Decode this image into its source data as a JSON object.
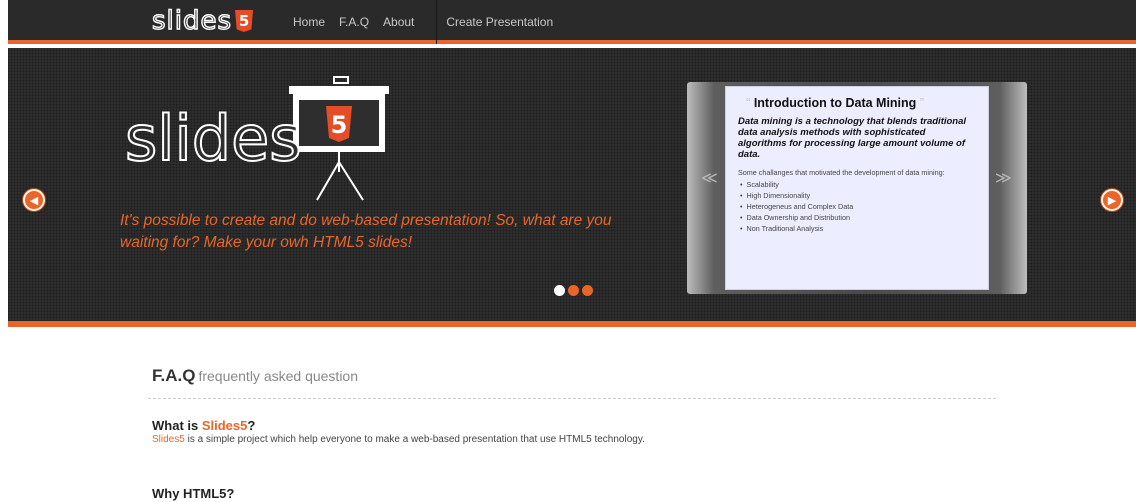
{
  "nav": {
    "logo_text": "slides",
    "logo_badge": "5",
    "home": "Home",
    "faq": "F.A.Q",
    "about": "About",
    "create": "Create Presentation"
  },
  "hero": {
    "big_logo_text": "slides",
    "big_logo_badge": "5",
    "tagline": "It's possible to create and do web-based presentation! So, what are you waiting for? Make your owh HTML5 slides!",
    "active_slide": 1,
    "slide_count": 3,
    "prev_arrow": "◀",
    "next_arrow": "▶"
  },
  "preview": {
    "prev": "≪",
    "next": "≫",
    "open_quote": "“",
    "close_quote": "”",
    "title": "Introduction to Data Mining",
    "quote": "Data mining is a technology that blends traditional data analysis methods with sophisticated algorithms for processing large amount volume of data.",
    "intro": "Some challanges that motivated the development of data mining:",
    "items": [
      "Scalability",
      "High Dimensionality",
      "Heterogeneus and Complex Data",
      "Data Ownership and Distribution",
      "Non Traditional Analysis"
    ]
  },
  "faq": {
    "title": "F.A.Q",
    "subtitle": "frequently asked question",
    "q1_prefix": "What is ",
    "q1_brand": "Slides5",
    "q1_suffix": "?",
    "a1_brand": "Slides5",
    "a1_text": " is a simple project which help everyone to make a web-based presentation that use HTML5 technology.",
    "q2": "Why HTML5?"
  },
  "colors": {
    "accent": "#e8662a",
    "nav_bg": "#2a2a2a",
    "hero_bg": "#2e2e2e",
    "html5": "#e44d26",
    "slide_bg": "#ecedff"
  }
}
